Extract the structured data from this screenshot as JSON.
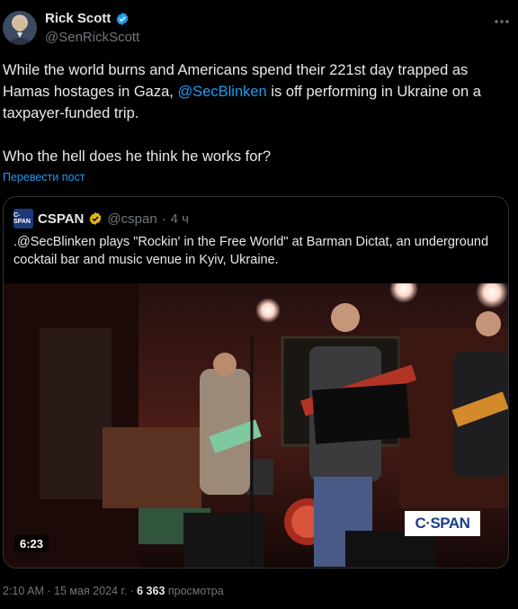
{
  "author": {
    "name": "Rick Scott",
    "handle": "@SenRickScott"
  },
  "tweet": {
    "text_part1": "While the world burns and Americans spend their 221st day trapped as Hamas hostages in Gaza, ",
    "mention": "@SecBlinken",
    "text_part2": " is off performing in Ukraine on a taxpayer-funded trip.",
    "text_line2": "Who the hell does he think he works for?",
    "translate_label": "Перевести пост"
  },
  "quoted": {
    "logo_text": "C-SPAN",
    "name": "CSPAN",
    "handle": "@cspan",
    "separator": "·",
    "time": "4 ч",
    "text": ".@SecBlinken plays \"Rockin' in the Free World\" at  Barman Dictat, an underground cocktail bar and music venue in Kyiv, Ukraine.",
    "video": {
      "duration": "6:23",
      "watermark": "C·SPAN"
    }
  },
  "meta": {
    "time": "2:10 AM",
    "separator": "·",
    "date": "15 мая 2024 г.",
    "separator2": "·",
    "views": "6 363",
    "views_label": "просмотра"
  },
  "colors": {
    "background": "#000000",
    "text": "#e7e9ea",
    "secondary": "#71767b",
    "link": "#1d9bf0",
    "border": "#2f3336",
    "verified_blue": "#1d9bf0",
    "verified_gold": "#e2b719"
  },
  "icons": {
    "more": "more-icon",
    "verified": "verified-badge-icon",
    "gold_verified": "gold-verified-badge-icon"
  }
}
